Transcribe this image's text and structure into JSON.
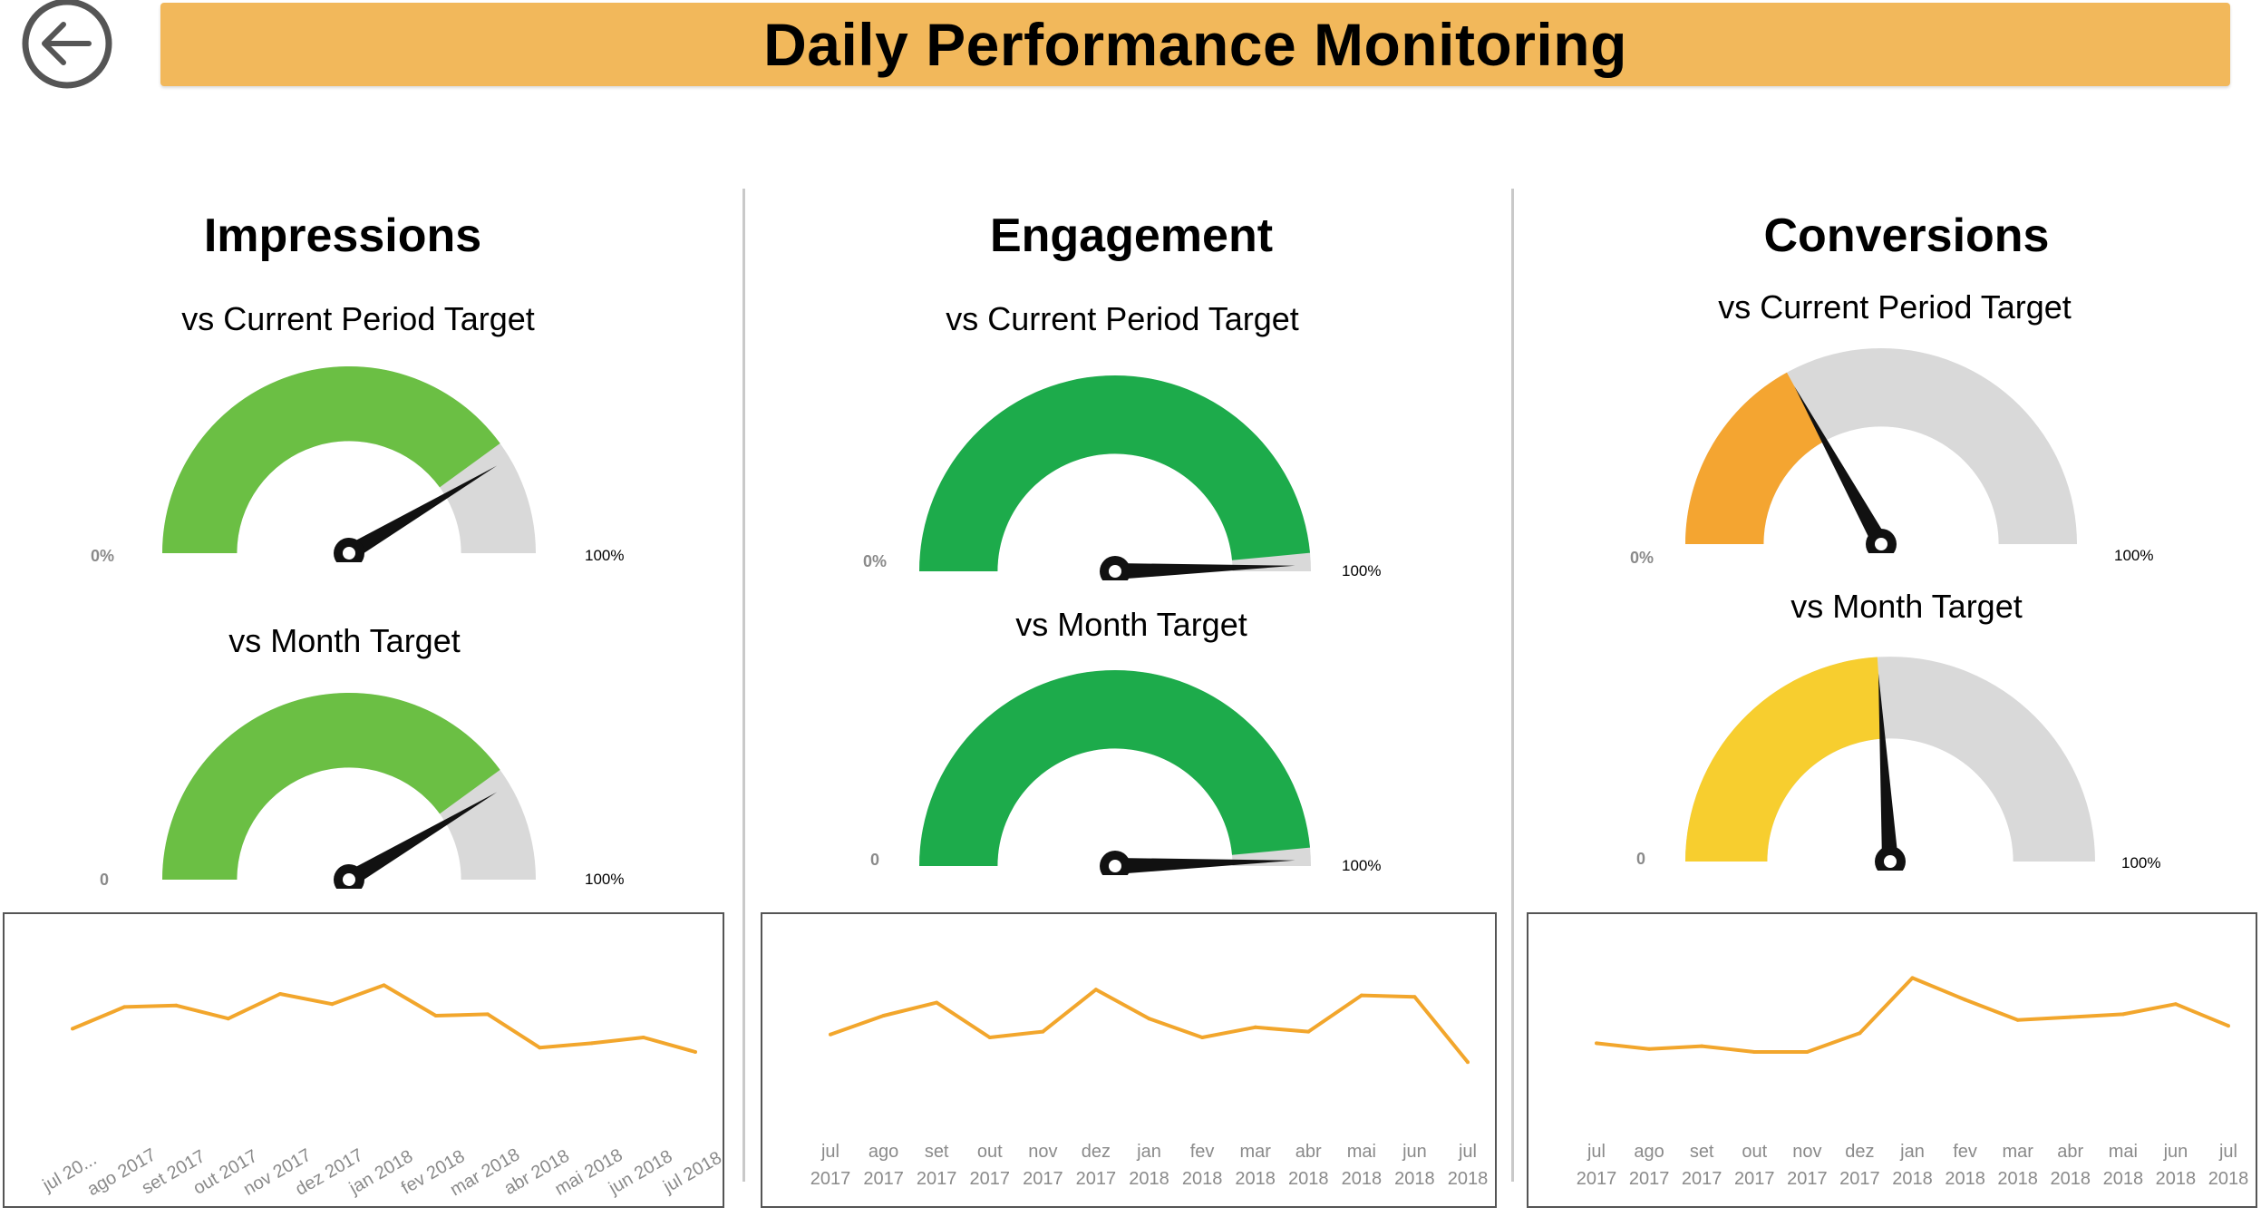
{
  "header": {
    "title": "Daily Performance Monitoring",
    "back_icon": "back-arrow-icon"
  },
  "colors": {
    "header_bg": "#F2B85B",
    "light_green": "#6BBF44",
    "dark_green": "#1DAB4B",
    "orange": "#F4A531",
    "yellow": "#F7CE2F",
    "gauge_track": "#D9D9D9",
    "line": "#F2A62C"
  },
  "panels": [
    {
      "title": "Impressions",
      "current": {
        "label": "vs Current Period Target",
        "min_label": "0%",
        "max_label": "100%",
        "value_fraction": 0.8,
        "needle_fraction": 0.83,
        "color": "#6BBF44"
      },
      "month": {
        "label": "vs Month Target",
        "min_label": "0",
        "max_label": "100%",
        "value_fraction": 0.8,
        "needle_fraction": 0.83,
        "color": "#6BBF44"
      },
      "chart_data": {
        "type": "line",
        "x": [
          "jul 20...",
          "ago 2017",
          "set 2017",
          "out 2017",
          "nov 2017",
          "dez 2017",
          "jan 2018",
          "fev 2018",
          "mar 2018",
          "abr 2018",
          "mai 2018",
          "jun 2018",
          "jul 2018"
        ],
        "values": [
          46,
          61,
          62,
          53,
          70,
          63,
          76,
          55,
          56,
          33,
          36,
          40,
          30
        ],
        "ylim": [
          0,
          100
        ],
        "tick_style": "rotated"
      }
    },
    {
      "title": "Engagement",
      "current": {
        "label": "vs Current Period Target",
        "min_label": "0%",
        "max_label": "100%",
        "value_fraction": 0.97,
        "needle_fraction": 0.99,
        "color": "#1DAB4B"
      },
      "month": {
        "label": "vs Month Target",
        "min_label": "0",
        "max_label": "100%",
        "value_fraction": 0.97,
        "needle_fraction": 0.99,
        "color": "#1DAB4B"
      },
      "chart_data": {
        "type": "line",
        "x": [
          [
            "jul",
            "2017"
          ],
          [
            "ago",
            "2017"
          ],
          [
            "set",
            "2017"
          ],
          [
            "out",
            "2017"
          ],
          [
            "nov",
            "2017"
          ],
          [
            "dez",
            "2017"
          ],
          [
            "jan",
            "2018"
          ],
          [
            "fev",
            "2018"
          ],
          [
            "mar",
            "2018"
          ],
          [
            "abr",
            "2018"
          ],
          [
            "mai",
            "2018"
          ],
          [
            "jun",
            "2018"
          ],
          [
            "jul",
            "2018"
          ]
        ],
        "values": [
          42,
          55,
          64,
          40,
          44,
          73,
          53,
          40,
          47,
          44,
          69,
          68,
          23
        ],
        "ylim": [
          0,
          100
        ],
        "tick_style": "two-line"
      }
    },
    {
      "title": "Conversions",
      "current": {
        "label": "vs Current Period Target",
        "min_label": "0%",
        "max_label": "100%",
        "value_fraction": 0.34,
        "needle_fraction": 0.34,
        "color": "#F4A531"
      },
      "month": {
        "label": "vs Month Target",
        "min_label": "0",
        "max_label": "100%",
        "value_fraction": 0.48,
        "needle_fraction": 0.48,
        "color": "#F7CE2F"
      },
      "chart_data": {
        "type": "line",
        "x": [
          [
            "jul",
            "2017"
          ],
          [
            "ago",
            "2017"
          ],
          [
            "set",
            "2017"
          ],
          [
            "out",
            "2017"
          ],
          [
            "nov",
            "2017"
          ],
          [
            "dez",
            "2017"
          ],
          [
            "jan",
            "2018"
          ],
          [
            "fev",
            "2018"
          ],
          [
            "mar",
            "2018"
          ],
          [
            "abr",
            "2018"
          ],
          [
            "mai",
            "2018"
          ],
          [
            "jun",
            "2018"
          ],
          [
            "jul",
            "2018"
          ]
        ],
        "values": [
          36,
          32,
          34,
          30,
          30,
          43,
          81,
          66,
          52,
          54,
          56,
          63,
          48
        ],
        "ylim": [
          0,
          100
        ],
        "tick_style": "two-line"
      }
    }
  ]
}
